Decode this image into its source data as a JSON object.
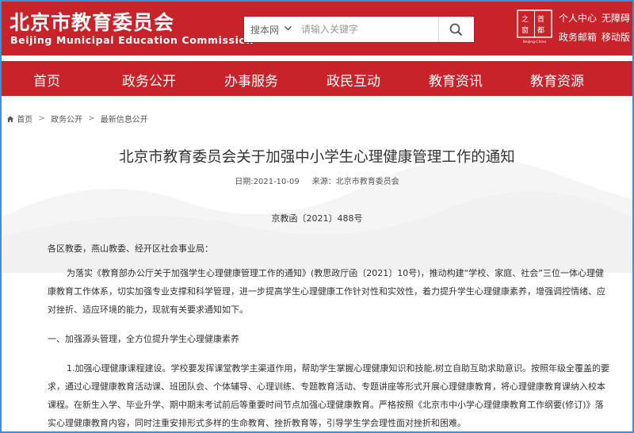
{
  "header": {
    "site_name": "北京市教育委员会",
    "site_name_en": "Beijing Municipal Education Commission",
    "search_scope": "搜本网",
    "search_placeholder": "请输入关键字",
    "seal_text": "首都",
    "seal_sub": "Beijing·China",
    "personal_center": "个人中心",
    "accessibility": "无障碍",
    "gov_mail": "政务邮箱",
    "mobile": "移动版"
  },
  "nav": {
    "items": [
      "首页",
      "政务公开",
      "办事服务",
      "政民互动",
      "教育资讯",
      "教育资源"
    ]
  },
  "breadcrumb": [
    "首页",
    "政务公开",
    "最新信息公开"
  ],
  "article": {
    "title": "北京市教育委员会关于加强中小学生心理健康管理工作的通知",
    "date": "日期:2021-10-09",
    "source": "来源：北京市教育委员会",
    "doc_number": "京教函〔2021〕488号",
    "salutation": "各区教委，燕山教委、经开区社会事业局：",
    "p1_lines": [
      "为落实《教育部办公厅关于加强学生心理健康管理工作的通知》(教思政厅函〔2021〕10号)，推动构建“学校、家庭、社会”三位一体心理健",
      "康教育工作体系，切实加强专业支撑和科学管理，进一步提高学生心理健康工作针对性和实效性，着力提升学生心理健康素养，增强调控情绪、应",
      "对挫折、适应环境的能力，现就有关要求通知如下。"
    ],
    "section1": "一、加强源头管理，全方位提升学生心理健康素养",
    "p2_lines": [
      "1.加强心理健康课程建设。学校要发挥课堂教学主渠道作用，帮助学生掌握心理健康知识和技能,树立自助互助求助意识。按照年级全覆盖的要",
      "求，通过心理健康教育活动课、班团队会、个体辅导、心理训练、专题教育活动、专题讲座等形式开展心理健康教育，将心理健康教育课纳入校本",
      "课程。在新生入学、毕业升学、期中期末考试前后等重要时间节点加强心理健康教育。严格按照《北京市中小学心理健康教育工作纲要(修订)》落",
      "实心理健康教育内容，同时注重安排形式多样的生命教育、挫折教育等，引导学生学会理性面对挫折和困难。"
    ]
  },
  "colors": {
    "brand_red": "#c8232a",
    "frame_blue": "#3d8fd6"
  }
}
